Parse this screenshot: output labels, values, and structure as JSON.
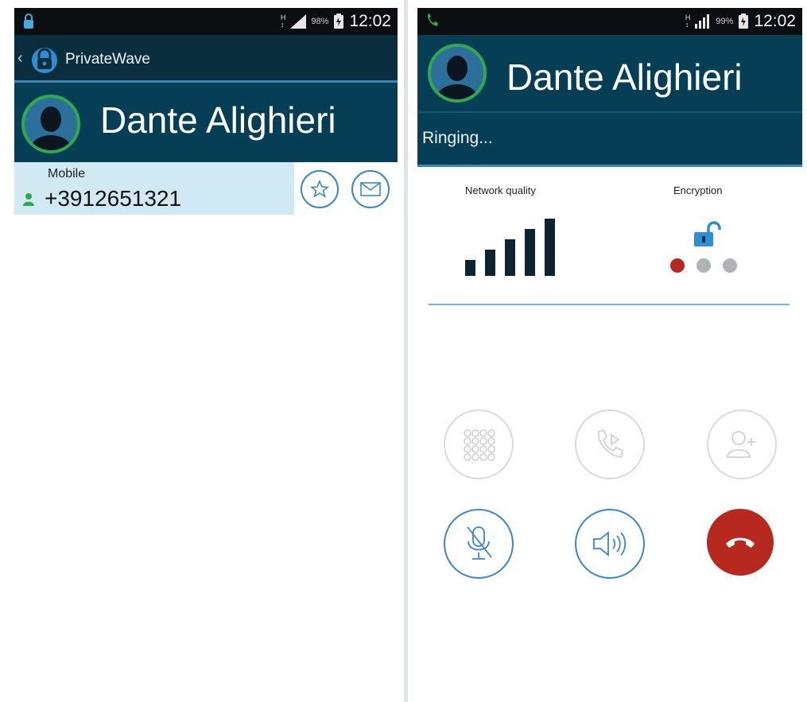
{
  "left_screen": {
    "status_bar": {
      "battery": "98%",
      "time": "12:02"
    },
    "app_bar": {
      "title": "PrivateWave"
    },
    "contact": {
      "name": "Dante Alighieri"
    },
    "phone_entry": {
      "type": "Mobile",
      "number": "+3912651321"
    }
  },
  "right_screen": {
    "status_bar": {
      "battery": "99%",
      "time": "12:02"
    },
    "call": {
      "name": "Dante Alighieri",
      "status": "Ringing..."
    },
    "network_quality": {
      "label": "Network quality",
      "level": 5,
      "max": 5
    },
    "encryption": {
      "label": "Encryption",
      "steps_done": 1,
      "steps_total": 3
    },
    "colors": {
      "brand": "#053e55",
      "accent": "#3b86c7",
      "hangup": "#b7291e",
      "ok": "#2fa84f"
    }
  }
}
